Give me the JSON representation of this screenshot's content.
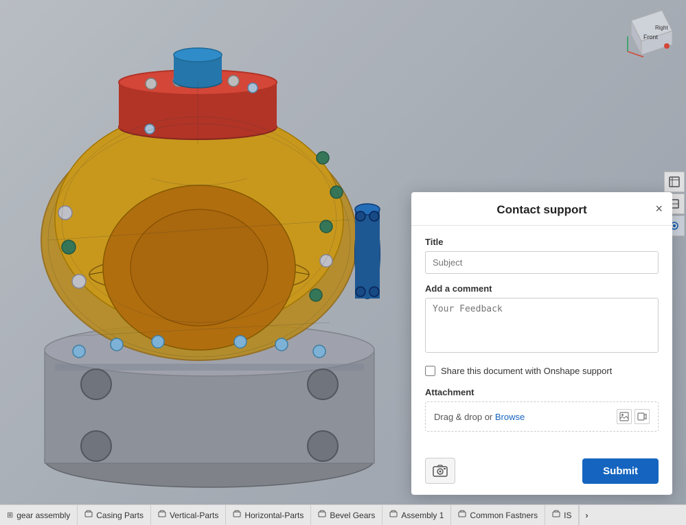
{
  "viewport": {
    "background_color": "#b5bcc5"
  },
  "nav_cube": {
    "front_label": "Front",
    "right_label": "Right"
  },
  "dialog": {
    "title": "Contact support",
    "close_icon": "×",
    "title_field": {
      "label": "Title",
      "placeholder": "Subject"
    },
    "comment_field": {
      "label": "Add a comment",
      "placeholder": "Your Feedback"
    },
    "share_checkbox": {
      "label": "Share this document with Onshape support"
    },
    "attachment": {
      "label": "Attachment",
      "drag_text": "Drag & drop or ",
      "browse_text": "Browse"
    },
    "submit_label": "Submit"
  },
  "tabs": [
    {
      "label": "gear assembly",
      "icon": "⊞",
      "active": false
    },
    {
      "label": "Casing Parts",
      "icon": "⊞",
      "active": false
    },
    {
      "label": "Vertical-Parts",
      "icon": "⊞",
      "active": false
    },
    {
      "label": "Horizontal-Parts",
      "icon": "⊞",
      "active": false
    },
    {
      "label": "Bevel Gears",
      "icon": "⊞",
      "active": false
    },
    {
      "label": "Assembly 1",
      "icon": "⊞",
      "active": false
    },
    {
      "label": "Common Fastners",
      "icon": "⊞",
      "active": false
    },
    {
      "label": "IS",
      "icon": "⊞",
      "active": false
    }
  ],
  "tab_arrow": "›"
}
